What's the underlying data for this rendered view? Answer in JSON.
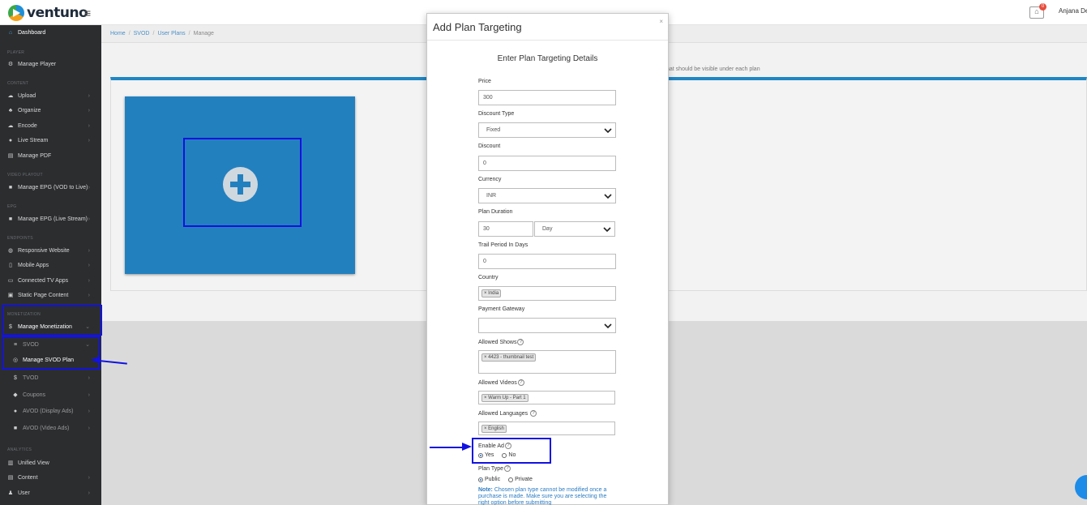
{
  "topbar": {
    "logo_text": "ventuno",
    "notification_count": "0",
    "username": "Anjana Dev"
  },
  "sidebar": {
    "dashboard": "Dashboard",
    "section_player": "PLAYER",
    "manage_player": "Manage Player",
    "section_content": "CONTENT",
    "upload": "Upload",
    "organize": "Organize",
    "encode": "Encode",
    "live_stream": "Live Stream",
    "manage_pdf": "Manage PDF",
    "section_video_playout": "VIDEO PLAYOUT",
    "manage_epg_vod": "Manage EPG (VOD to Live)",
    "section_epg": "EPG",
    "manage_epg_live": "Manage EPG (Live Stream)",
    "section_endpoints": "ENDPOINTS",
    "responsive_website": "Responsive Website",
    "mobile_apps": "Mobile Apps",
    "connected_tv_apps": "Connected TV Apps",
    "static_page_content": "Static Page Content",
    "section_monetization": "MONETIZATION",
    "manage_monetization": "Manage Monetization",
    "svod": "SVOD",
    "manage_svod_plan": "Manage SVOD Plan",
    "tvod": "TVOD",
    "coupons": "Coupons",
    "avod_display": "AVOD (Display Ads)",
    "avod_video": "AVOD (Video Ads)",
    "section_analytics": "ANALYTICS",
    "unified_view": "Unified View",
    "content": "Content",
    "user": "User"
  },
  "breadcrumb": {
    "home": "Home",
    "svod": "SVOD",
    "user_plans": "User Plans",
    "manage": "Manage"
  },
  "main": {
    "hint_text": "hat should be visible under each plan"
  },
  "modal": {
    "title": "Add Plan Targeting",
    "close": "×",
    "subtitle": "Enter Plan Targeting Details",
    "price_label": "Price",
    "price_value": "300",
    "discount_type_label": "Discount Type",
    "discount_type_value": "Fixed",
    "discount_label": "Discount",
    "discount_value": "0",
    "currency_label": "Currency",
    "currency_value": "INR",
    "plan_duration_label": "Plan Duration",
    "plan_duration_value": "30",
    "plan_duration_unit": "Day",
    "trail_period_label": "Trail Period In Days",
    "trail_period_value": "0",
    "country_label": "Country",
    "country_tag": "× India",
    "payment_gateway_label": "Payment Gateway",
    "allowed_shows_label": "Allowed Shows",
    "allowed_shows_tag": "× 4423 - thumbnail test",
    "allowed_videos_label": "Allowed Videos",
    "allowed_videos_tag": "× Warm Up - Part 1",
    "allowed_languages_label": "Allowed Languages",
    "allowed_languages_tag": "× English",
    "enable_ad_label": "Enable Ad",
    "yes_label": "Yes",
    "no_label": "No",
    "plan_type_label": "Plan Type",
    "public_label": "Public",
    "private_label": "Private",
    "note_prefix": "Note:",
    "note_text": " Chosen plan type cannot be modified once a purchase is made. Make sure you are selecting the right option before submitting",
    "help_glyph": "?"
  },
  "colors": {
    "accent": "#2380bf",
    "annotation": "#1212e0",
    "sidebar_bg": "#2b2d2f"
  }
}
